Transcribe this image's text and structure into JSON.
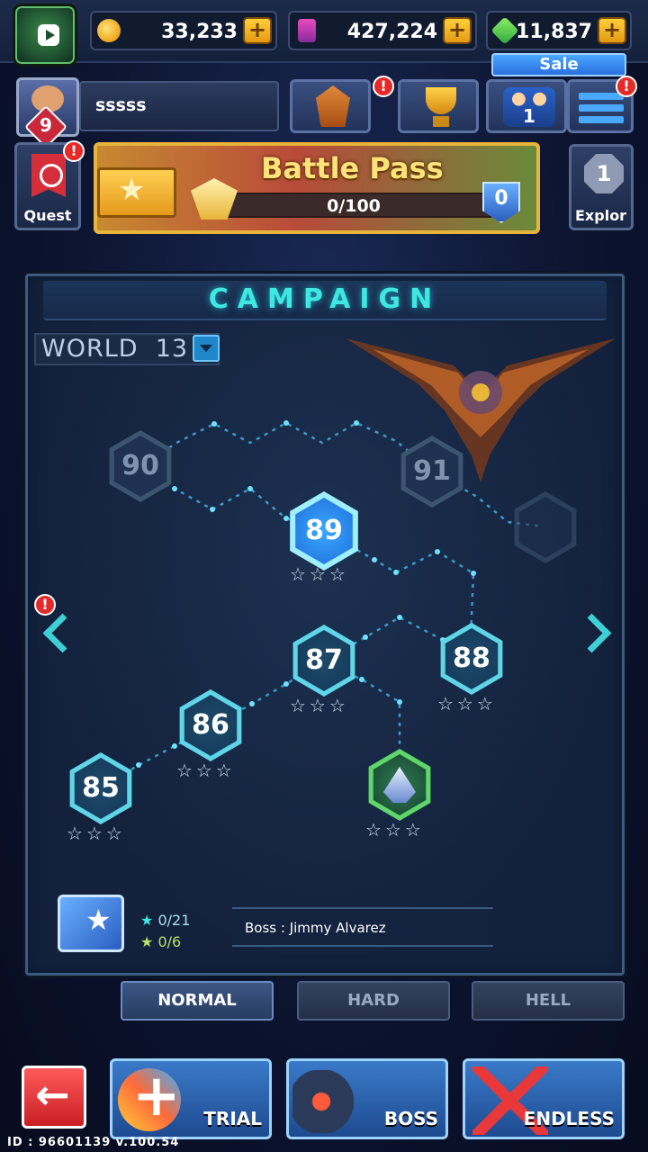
{
  "currencies": [
    {
      "icon": "coin-icon",
      "value": "33,233"
    },
    {
      "icon": "card-icon",
      "value": "427,224"
    },
    {
      "icon": "gem-icon",
      "value": "11,837"
    }
  ],
  "sale_label": "Sale",
  "profile": {
    "name": "sssss",
    "level": "9"
  },
  "alerts": {
    "rank": "!",
    "menu": "!",
    "quest": "!",
    "world": "!"
  },
  "team_count": "1",
  "quest_label": "Quest",
  "battle_pass": {
    "title": "Battle Pass",
    "progress": "0/100",
    "progress_fraction": 0,
    "level": "0"
  },
  "explore": {
    "count": "1",
    "label": "Explor"
  },
  "campaign": {
    "title": "CAMPAIGN",
    "world": "WORLD  13",
    "stages": [
      {
        "id": "85",
        "state": "done",
        "stars": "☆☆☆"
      },
      {
        "id": "86",
        "state": "done",
        "stars": "☆☆☆"
      },
      {
        "id": "87",
        "state": "done",
        "stars": "☆☆☆"
      },
      {
        "id": "88",
        "state": "done",
        "stars": "☆☆☆"
      },
      {
        "id": "89",
        "state": "active",
        "stars": "☆☆☆"
      },
      {
        "id": "90",
        "state": "locked",
        "stars": ""
      },
      {
        "id": "91",
        "state": "locked",
        "stars": ""
      },
      {
        "id": "boss",
        "state": "boss",
        "stars": "☆☆☆"
      }
    ],
    "stars_req": "0/21",
    "stars_bonus": "0/6",
    "boss_line": "Boss : Jimmy Alvarez"
  },
  "difficulty_tabs": [
    "NORMAL",
    "HARD",
    "HELL"
  ],
  "modes": [
    "TRIAL",
    "BOSS",
    "ENDLESS"
  ],
  "footer": "ID : 96601139 v.100.54",
  "colors": {
    "accent": "#3ee8e0",
    "gold": "#e8b43a",
    "alert": "#e52a2a",
    "back": "#c81e24"
  }
}
